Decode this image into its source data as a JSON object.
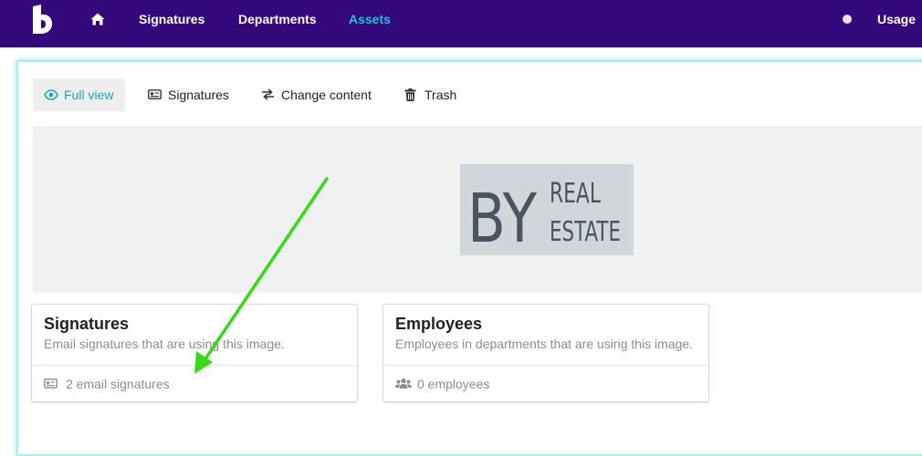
{
  "nav": {
    "logo_letter": "B",
    "home_icon": "home-icon",
    "items": [
      {
        "label": "Signatures",
        "active": false
      },
      {
        "label": "Departments",
        "active": false
      },
      {
        "label": "Assets",
        "active": true
      }
    ],
    "right_label": "Usage"
  },
  "tabs": [
    {
      "label": "Full view",
      "icon": "eye-icon",
      "active": true
    },
    {
      "label": "Signatures",
      "icon": "id-card-icon",
      "active": false
    },
    {
      "label": "Change content",
      "icon": "exchange-icon",
      "active": false
    },
    {
      "label": "Trash",
      "icon": "trash-icon",
      "active": false
    }
  ],
  "asset_image": {
    "big_letters": "BY",
    "line1": "REAL",
    "line2": "ESTATE"
  },
  "cards": [
    {
      "title": "Signatures",
      "description": "Email signatures that are using this image.",
      "footer": "2 email signatures",
      "footer_icon": "id-card-icon"
    },
    {
      "title": "Employees",
      "description": "Employees in departments that are using this image.",
      "footer": "0 employees",
      "footer_icon": "users-icon"
    }
  ],
  "colors": {
    "nav_bg": "#33087a",
    "accent": "#19c6cf",
    "annotation_arrow": "#33dd11"
  }
}
